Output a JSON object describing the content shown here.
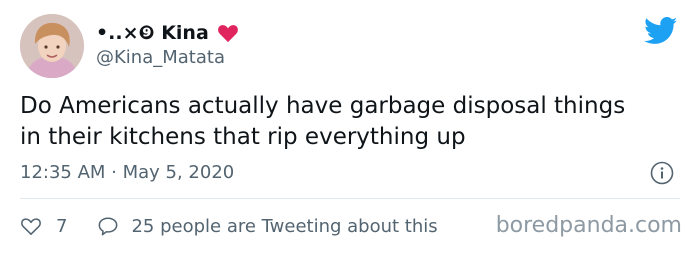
{
  "user": {
    "display_name": "•..×❾ Kina",
    "handle": "@Kina_Matata",
    "heart_color": "#e0245e"
  },
  "tweet": {
    "line1": "Do Americans actually have garbage disposal things",
    "line2": "in their kitchens that rip everything up",
    "timestamp": "12:35 AM · May 5, 2020"
  },
  "engagement": {
    "likes": "7",
    "tweeting": "25 people are Tweeting about this"
  },
  "icons": {
    "brand": "twitter-bird-icon",
    "info": "info-icon",
    "like": "heart-outline-icon",
    "reply": "speech-bubble-icon"
  },
  "colors": {
    "twitter_blue": "#1da1f2",
    "secondary_text": "#536471"
  },
  "watermark": "boredpanda.com"
}
